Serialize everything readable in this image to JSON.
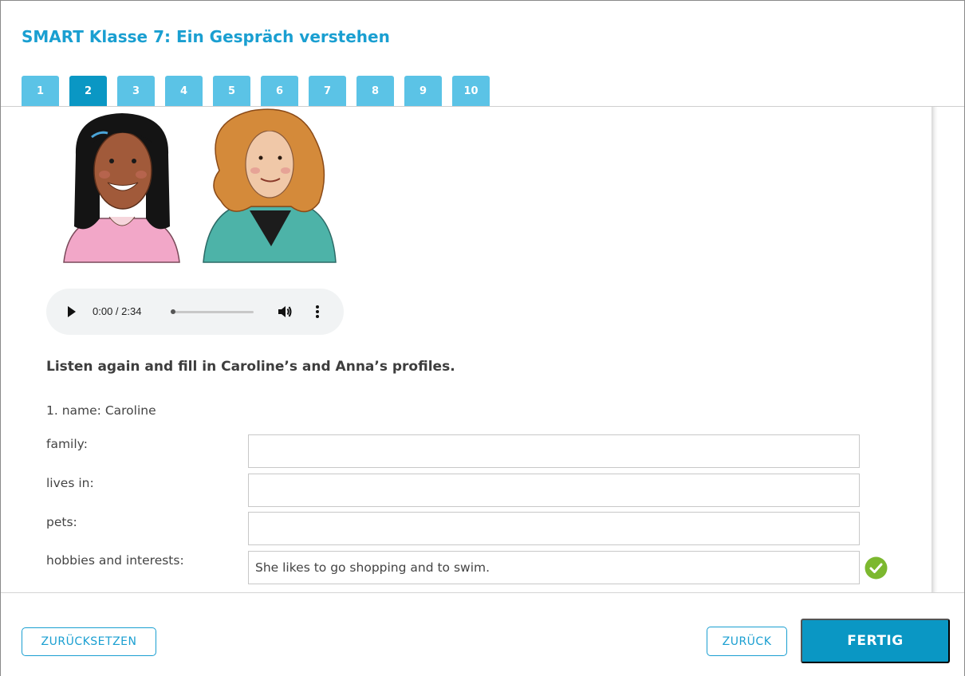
{
  "header": {
    "title": "SMART Klasse 7: Ein Gespräch verstehen"
  },
  "tabs": [
    {
      "label": "1"
    },
    {
      "label": "2"
    },
    {
      "label": "3"
    },
    {
      "label": "4"
    },
    {
      "label": "5"
    },
    {
      "label": "6"
    },
    {
      "label": "7"
    },
    {
      "label": "8"
    },
    {
      "label": "9"
    },
    {
      "label": "10"
    }
  ],
  "active_tab": "2",
  "audio": {
    "time": "0:00 / 2:34",
    "progress": 0.0
  },
  "instruction": "Listen again and fill in Caroline’s and Anna’s profiles.",
  "profile": {
    "name_line": "1. name: Caroline",
    "fields": [
      {
        "label": "family:",
        "value": ""
      },
      {
        "label": "lives in:",
        "value": ""
      },
      {
        "label": "pets:",
        "value": ""
      },
      {
        "label": "hobbies and interests:",
        "value": "She likes to go shopping and to swim."
      }
    ]
  },
  "footer": {
    "reset_label": "ZURÜCKSETZEN",
    "back_label": "ZURÜCK",
    "done_label": "FERTIG"
  },
  "colors": {
    "accent": "#1a9fd1",
    "tab": "#5bc3e6",
    "tab_active": "#0a97c4",
    "success": "#7cb82f"
  }
}
